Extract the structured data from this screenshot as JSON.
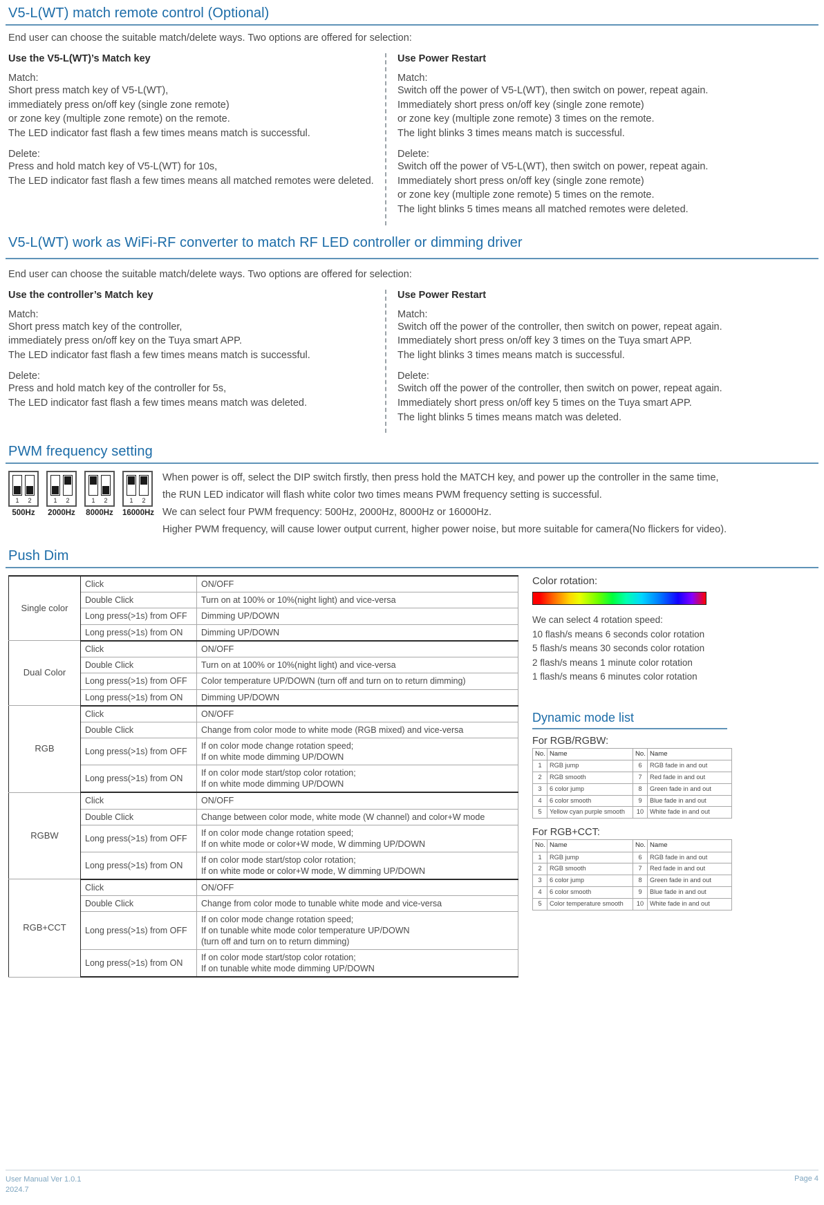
{
  "section1": {
    "title": "V5-L(WT) match remote control (Optional)",
    "intro": "End user can choose the suitable match/delete ways. Two options are offered for selection:",
    "left": {
      "heading": "Use the V5-L(WT)’s Match key",
      "match_label": "Match:",
      "match_lines": [
        "Short press match key of V5-L(WT),",
        "immediately press on/off key (single zone remote)",
        "or zone key (multiple zone remote) on the remote.",
        "The LED indicator fast flash a few times means match is successful."
      ],
      "delete_label": "Delete:",
      "delete_lines": [
        "Press and hold match key of V5-L(WT) for 10s,",
        "The LED indicator fast flash a few times means all matched remotes were deleted."
      ]
    },
    "right": {
      "heading": "Use Power Restart",
      "match_label": "Match:",
      "match_lines": [
        "Switch off the power of V5-L(WT), then switch on power, repeat again.",
        "Immediately short press on/off key (single zone remote)",
        "or zone key (multiple zone remote) 3 times on the remote.",
        "The light blinks 3 times means match is successful."
      ],
      "delete_label": "Delete:",
      "delete_lines": [
        "Switch off the power of V5-L(WT), then switch on power, repeat again.",
        "Immediately short press on/off key (single zone remote)",
        "or zone key (multiple zone remote) 5 times on the remote.",
        "The light blinks 5 times means all matched remotes were deleted."
      ]
    }
  },
  "section2": {
    "title": "V5-L(WT) work as WiFi-RF converter to match RF LED controller or dimming driver",
    "intro": "End user can choose the suitable match/delete ways. Two options are offered for selection:",
    "left": {
      "heading": "Use the controller’s Match key",
      "match_label": "Match:",
      "match_lines": [
        "Short press match key of the controller,",
        "immediately press on/off key on the Tuya smart APP.",
        "The LED indicator fast flash a few times means match is successful."
      ],
      "delete_label": "Delete:",
      "delete_lines": [
        "Press and hold match key of the controller for 5s,",
        "The LED indicator fast flash a few times means match was deleted."
      ]
    },
    "right": {
      "heading": "Use Power Restart",
      "match_label": "Match:",
      "match_lines": [
        "Switch off the power of the controller, then switch on power, repeat again.",
        "Immediately short press on/off key 3 times on the Tuya smart APP.",
        "The light blinks 3 times means match is successful."
      ],
      "delete_label": "Delete:",
      "delete_lines": [
        "Switch off the power of the controller, then switch on power, repeat again.",
        "Immediately short press on/off key 5 times on the Tuya smart APP.",
        "The light blinks 5 times means match was deleted."
      ]
    }
  },
  "pwm": {
    "title": "PWM frequency setting",
    "switches": [
      {
        "caption": "500Hz",
        "sw1": "down",
        "sw2": "down",
        "n1": "1",
        "n2": "2"
      },
      {
        "caption": "2000Hz",
        "sw1": "down",
        "sw2": "up",
        "n1": "1",
        "n2": "2"
      },
      {
        "caption": "8000Hz",
        "sw1": "up",
        "sw2": "down",
        "n1": "1",
        "n2": "2"
      },
      {
        "caption": "16000Hz",
        "sw1": "up",
        "sw2": "up",
        "n1": "1",
        "n2": "2"
      }
    ],
    "lines": [
      "When power is off, select the DIP switch firstly, then press hold the MATCH key, and power up the controller in the same time,",
      "the RUN LED indicator will flash white color two times means PWM frequency setting is successful.",
      "We can select four PWM frequency: 500Hz, 2000Hz, 8000Hz or 16000Hz.",
      "Higher PWM frequency, will cause lower output current, higher power noise, but more suitable for camera(No flickers for video)."
    ]
  },
  "pushdim": {
    "title": "Push Dim",
    "groups": [
      {
        "mode": "Single color",
        "rows": [
          {
            "action": "Click",
            "result": "ON/OFF"
          },
          {
            "action": "Double Click",
            "result": "Turn on at 100% or 10%(night light) and vice-versa"
          },
          {
            "action": "Long press(>1s) from OFF",
            "result": "Dimming UP/DOWN"
          },
          {
            "action": "Long press(>1s) from ON",
            "result": "Dimming UP/DOWN"
          }
        ]
      },
      {
        "mode": "Dual Color",
        "rows": [
          {
            "action": "Click",
            "result": "ON/OFF"
          },
          {
            "action": "Double Click",
            "result": "Turn on at 100% or 10%(night light) and vice-versa"
          },
          {
            "action": "Long press(>1s) from OFF",
            "result": "Color temperature UP/DOWN (turn off and turn on to return dimming)"
          },
          {
            "action": "Long press(>1s) from ON",
            "result": "Dimming UP/DOWN"
          }
        ]
      },
      {
        "mode": "RGB",
        "rows": [
          {
            "action": "Click",
            "result": "ON/OFF"
          },
          {
            "action": "Double Click",
            "result": "Change from color mode to white mode (RGB  mixed)  and vice-versa"
          },
          {
            "action": "Long press(>1s) from OFF",
            "result": "If on color mode change rotation speed;\nIf on white mode dimming UP/DOWN"
          },
          {
            "action": "Long press(>1s) from ON",
            "result": "If on color mode start/stop color rotation;\nIf on white mode dimming UP/DOWN"
          }
        ]
      },
      {
        "mode": "RGBW",
        "rows": [
          {
            "action": "Click",
            "result": "ON/OFF"
          },
          {
            "action": "Double Click",
            "result": "Change between color mode, white mode (W  channel) and color+W mode"
          },
          {
            "action": "Long press(>1s) from OFF",
            "result": "If on color mode change rotation speed;\nIf on white mode or color+W mode, W dimming UP/DOWN"
          },
          {
            "action": "Long press(>1s) from ON",
            "result": "If on color mode start/stop color rotation;\nIf on white mode or color+W mode, W dimming UP/DOWN"
          }
        ]
      },
      {
        "mode": "RGB+CCT",
        "rows": [
          {
            "action": "Click",
            "result": "ON/OFF"
          },
          {
            "action": "Double Click",
            "result": "Change from color mode to tunable white mode and vice-versa"
          },
          {
            "action": "Long press(>1s) from OFF",
            "result": "If on color mode change rotation speed;\nIf on tunable white mode color temperature UP/DOWN\n(turn off and turn on to return dimming)"
          },
          {
            "action": "Long press(>1s) from ON",
            "result": "If on color mode start/stop color rotation;\nIf on tunable white mode dimming UP/DOWN"
          }
        ]
      }
    ]
  },
  "color_rotation": {
    "title": "Color rotation:",
    "lead": "We can select 4 rotation speed:",
    "lines": [
      "10 flash/s means 6 seconds color rotation",
      "5 flash/s means 30 seconds color rotation",
      "2 flash/s means 1 minute color rotation",
      "1 flash/s means 6 minutes color rotation"
    ]
  },
  "dynamic": {
    "title": "Dynamic mode list",
    "tables": [
      {
        "subtitle": "For RGB/RGBW:",
        "headers": [
          "No.",
          "Name",
          "No.",
          "Name"
        ],
        "rows": [
          [
            "1",
            "RGB jump",
            "6",
            "RGB fade in and out"
          ],
          [
            "2",
            "RGB smooth",
            "7",
            "Red fade in and out"
          ],
          [
            "3",
            "6 color jump",
            "8",
            "Green fade in and out"
          ],
          [
            "4",
            "6 color smooth",
            "9",
            "Blue fade in and out"
          ],
          [
            "5",
            "Yellow cyan purple smooth",
            "10",
            "White fade in and out"
          ]
        ]
      },
      {
        "subtitle": "For RGB+CCT:",
        "headers": [
          "No.",
          "Name",
          "No.",
          "Name"
        ],
        "rows": [
          [
            "1",
            "RGB jump",
            "6",
            "RGB fade in and out"
          ],
          [
            "2",
            "RGB smooth",
            "7",
            "Red fade in and out"
          ],
          [
            "3",
            "6 color jump",
            "8",
            "Green fade in and out"
          ],
          [
            "4",
            "6 color smooth",
            "9",
            "Blue fade in and out"
          ],
          [
            "5",
            "Color temperature smooth",
            "10",
            "White fade in and out"
          ]
        ]
      }
    ]
  },
  "footer": {
    "manual_version": "User Manual Ver 1.0.1",
    "date": "2024.7",
    "page": "Page 4"
  }
}
